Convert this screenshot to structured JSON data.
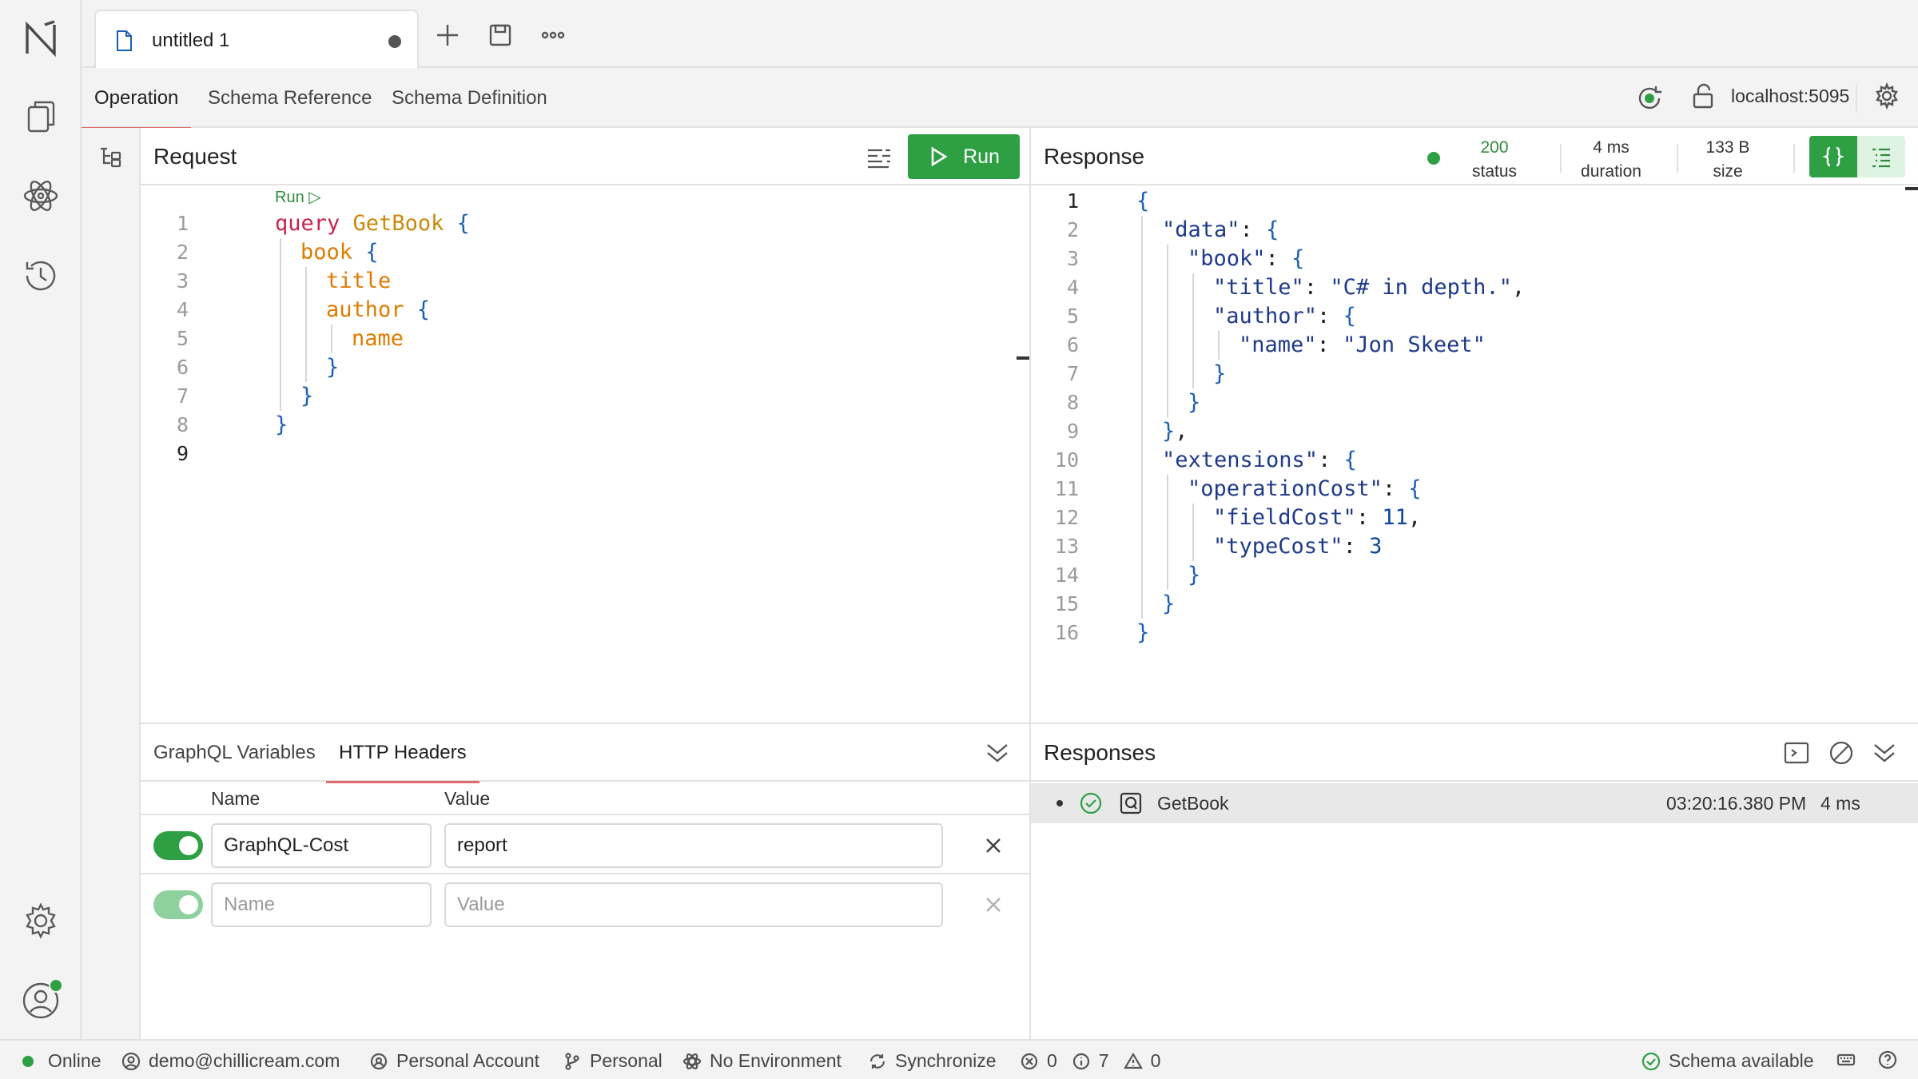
{
  "tab": {
    "title": "untitled 1"
  },
  "subnav": {
    "tabs": [
      "Operation",
      "Schema Reference",
      "Schema Definition"
    ],
    "endpoint": "localhost:5095"
  },
  "request": {
    "title": "Request",
    "run_label": "Run",
    "codelens": "Run ▷",
    "lines": [
      {
        "n": "1",
        "tokens": [
          [
            "kw",
            "query "
          ],
          [
            "op-name",
            "GetBook "
          ],
          [
            "brace",
            "{"
          ]
        ],
        "indent": 0
      },
      {
        "n": "2",
        "tokens": [
          [
            "field",
            "book "
          ],
          [
            "brace",
            "{"
          ]
        ],
        "indent": 1
      },
      {
        "n": "3",
        "tokens": [
          [
            "field",
            "title"
          ]
        ],
        "indent": 2
      },
      {
        "n": "4",
        "tokens": [
          [
            "field",
            "author "
          ],
          [
            "brace",
            "{"
          ]
        ],
        "indent": 2
      },
      {
        "n": "5",
        "tokens": [
          [
            "field",
            "name"
          ]
        ],
        "indent": 3
      },
      {
        "n": "6",
        "tokens": [
          [
            "brace",
            "}"
          ]
        ],
        "indent": 2
      },
      {
        "n": "7",
        "tokens": [
          [
            "brace",
            "}"
          ]
        ],
        "indent": 1
      },
      {
        "n": "8",
        "tokens": [
          [
            "brace",
            "}"
          ]
        ],
        "indent": 0
      },
      {
        "n": "9",
        "tokens": [],
        "indent": 0
      }
    ]
  },
  "response": {
    "title": "Response",
    "status_value": "200",
    "status_label": "status",
    "duration_value": "4 ms",
    "duration_label": "duration",
    "size_value": "133 B",
    "size_label": "size",
    "lines": [
      {
        "n": "1",
        "indent": 0,
        "tokens": [
          [
            "jbrace",
            "{"
          ]
        ]
      },
      {
        "n": "2",
        "indent": 1,
        "tokens": [
          [
            "jkey",
            "\"data\""
          ],
          [
            "plain",
            ": "
          ],
          [
            "jbrace",
            "{"
          ]
        ]
      },
      {
        "n": "3",
        "indent": 2,
        "tokens": [
          [
            "jkey",
            "\"book\""
          ],
          [
            "plain",
            ": "
          ],
          [
            "jbrace",
            "{"
          ]
        ]
      },
      {
        "n": "4",
        "indent": 3,
        "tokens": [
          [
            "jkey",
            "\"title\""
          ],
          [
            "plain",
            ": "
          ],
          [
            "jstr",
            "\"C# in depth.\""
          ],
          [
            "plain",
            ","
          ]
        ]
      },
      {
        "n": "5",
        "indent": 3,
        "tokens": [
          [
            "jkey",
            "\"author\""
          ],
          [
            "plain",
            ": "
          ],
          [
            "jbrace",
            "{"
          ]
        ]
      },
      {
        "n": "6",
        "indent": 4,
        "tokens": [
          [
            "jkey",
            "\"name\""
          ],
          [
            "plain",
            ": "
          ],
          [
            "jstr",
            "\"Jon Skeet\""
          ]
        ]
      },
      {
        "n": "7",
        "indent": 3,
        "tokens": [
          [
            "jbrace",
            "}"
          ]
        ]
      },
      {
        "n": "8",
        "indent": 2,
        "tokens": [
          [
            "jbrace",
            "}"
          ]
        ]
      },
      {
        "n": "9",
        "indent": 1,
        "tokens": [
          [
            "jbrace",
            "}"
          ],
          [
            "plain",
            ","
          ]
        ]
      },
      {
        "n": "10",
        "indent": 1,
        "tokens": [
          [
            "jkey",
            "\"extensions\""
          ],
          [
            "plain",
            ": "
          ],
          [
            "jbrace",
            "{"
          ]
        ]
      },
      {
        "n": "11",
        "indent": 2,
        "tokens": [
          [
            "jkey",
            "\"operationCost\""
          ],
          [
            "plain",
            ": "
          ],
          [
            "jbrace",
            "{"
          ]
        ]
      },
      {
        "n": "12",
        "indent": 3,
        "tokens": [
          [
            "jkey",
            "\"fieldCost\""
          ],
          [
            "plain",
            ": "
          ],
          [
            "jnum",
            "11"
          ],
          [
            "plain",
            ","
          ]
        ]
      },
      {
        "n": "13",
        "indent": 3,
        "tokens": [
          [
            "jkey",
            "\"typeCost\""
          ],
          [
            "plain",
            ": "
          ],
          [
            "jnum",
            "3"
          ]
        ]
      },
      {
        "n": "14",
        "indent": 2,
        "tokens": [
          [
            "jbrace",
            "}"
          ]
        ]
      },
      {
        "n": "15",
        "indent": 1,
        "tokens": [
          [
            "jbrace",
            "}"
          ]
        ]
      },
      {
        "n": "16",
        "indent": 0,
        "tokens": [
          [
            "jbrace",
            "}"
          ]
        ]
      }
    ]
  },
  "bottom": {
    "tabs": [
      "GraphQL Variables",
      "HTTP Headers"
    ],
    "col_name": "Name",
    "col_value": "Value",
    "rows": [
      {
        "name": "GraphQL-Cost",
        "value": "report"
      }
    ],
    "name_placeholder": "Name",
    "value_placeholder": "Value"
  },
  "responses": {
    "title": "Responses",
    "items": [
      {
        "name": "GetBook",
        "time": "03:20:16.380 PM",
        "duration": "4 ms"
      }
    ]
  },
  "statusbar": {
    "online": "Online",
    "user": "demo@chillicream.com",
    "account": "Personal Account",
    "workspace": "Personal",
    "environment": "No Environment",
    "sync": "Synchronize",
    "errors": "0",
    "infos": "7",
    "warnings": "0",
    "schema": "Schema available"
  },
  "colors": {
    "accent_green": "#2ea043",
    "tab_underline": "#e06a6a",
    "online_dot": "#2ea043"
  }
}
